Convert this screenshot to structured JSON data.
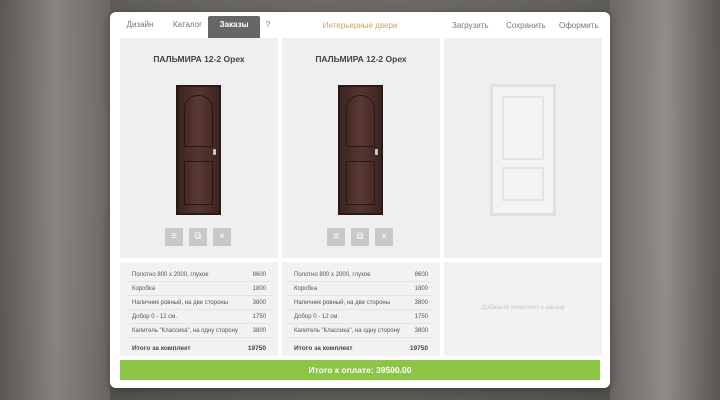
{
  "tabs": [
    {
      "label": "Дизайн",
      "active": false
    },
    {
      "label": "Каталог",
      "active": false
    },
    {
      "label": "Заказы",
      "active": true
    },
    {
      "label": "?",
      "active": false
    }
  ],
  "center_title": "Интерьерные двери",
  "actions": {
    "load": "Загрузить",
    "save": "Сохранить",
    "order": "Оформить"
  },
  "colors": {
    "accent": "#c9a46a",
    "pay_bar": "#8cc445",
    "active_tab": "#666666"
  },
  "doors": [
    {
      "title": "ПАЛЬМИРА 12-2 Орех",
      "icons": [
        "list-icon",
        "copy-icon",
        "close-icon"
      ],
      "specs": [
        {
          "name": "Полотно 800 x 2000, глухое",
          "value": "8600"
        },
        {
          "name": "Коробка",
          "value": "1800"
        },
        {
          "name": "Наличник ровный, на две стороны",
          "value": "3800"
        },
        {
          "name": "Добор 0 - 12 см.",
          "value": "1750"
        },
        {
          "name": "Капитель \"Классика\", на одну сторону",
          "value": "3800"
        }
      ],
      "total_label": "Итого за комплект",
      "total_value": "19750"
    },
    {
      "title": "ПАЛЬМИРА 12-2 Орех",
      "icons": [
        "list-icon",
        "copy-icon",
        "close-icon"
      ],
      "specs": [
        {
          "name": "Полотно 800 x 2000, глухое",
          "value": "8600"
        },
        {
          "name": "Коробка",
          "value": "1800"
        },
        {
          "name": "Наличник ровный, на две стороны",
          "value": "3800"
        },
        {
          "name": "Добор 0 - 12 см.",
          "value": "1750"
        },
        {
          "name": "Капитель \"Классика\", на одну сторону",
          "value": "3800"
        }
      ],
      "total_label": "Итого за комплект",
      "total_value": "19750"
    }
  ],
  "empty_slot_hint": "Добавьте комплект к заказу",
  "pay_total": "Итого к оплате:  39500.00"
}
